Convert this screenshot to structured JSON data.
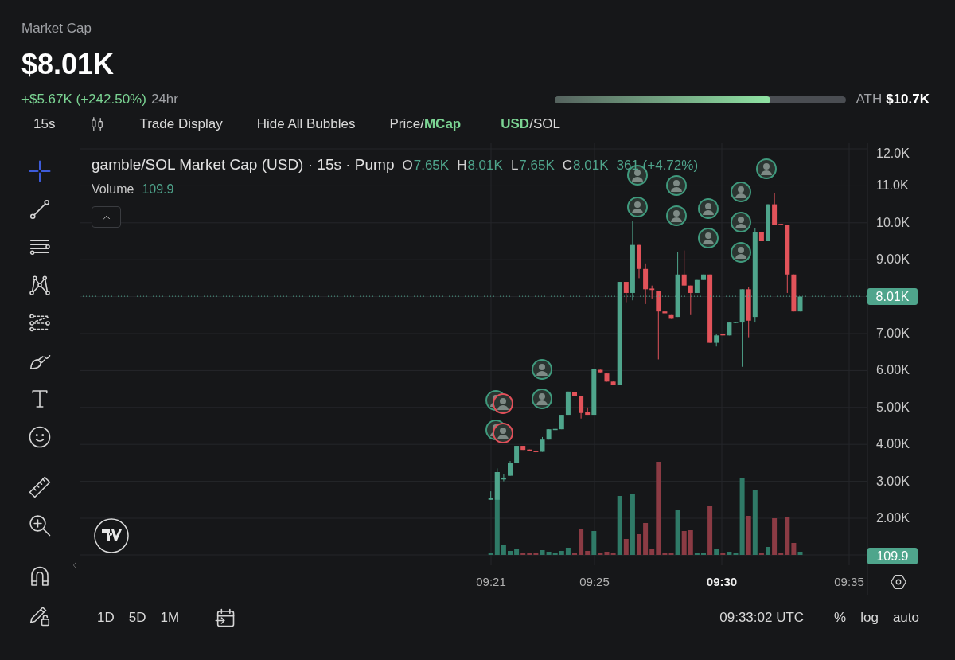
{
  "header": {
    "label": "Market Cap",
    "value": "$8.01K",
    "change": "+$5.67K (+242.50%)",
    "period": "24hr"
  },
  "ath": {
    "label": "ATH",
    "value": "$10.7K",
    "level": 0.74
  },
  "toolbar": {
    "interval": "15s",
    "buttons": [
      "Trade Display",
      "Hide All Bubbles"
    ],
    "toggles": [
      {
        "separator": "/",
        "options": [
          {
            "label": "Price",
            "selected": false
          },
          {
            "label": "MCap",
            "selected": true
          }
        ]
      },
      {
        "separator": "/",
        "options": [
          {
            "label": "USD",
            "selected": true
          },
          {
            "label": "SOL",
            "selected": false
          }
        ]
      }
    ]
  },
  "drawing_tools": [
    {
      "kind": "crosshair",
      "selected": true
    },
    {
      "kind": "trend",
      "selected": false
    },
    {
      "kind": "lines",
      "selected": false
    },
    {
      "kind": "pattern",
      "selected": false
    },
    {
      "kind": "fib",
      "selected": false
    },
    {
      "kind": "brush",
      "selected": false
    },
    {
      "kind": "text",
      "selected": false
    },
    {
      "kind": "emoji",
      "selected": false
    },
    {
      "kind": "ruler",
      "selected": false
    },
    {
      "kind": "zoom",
      "selected": false
    },
    {
      "kind": "magnet",
      "selected": false
    },
    {
      "kind": "lock",
      "selected": false
    }
  ],
  "chart": {
    "title": "gamble/SOL Market Cap (USD) · 15s · Pump",
    "ohlc": [
      {
        "key": "O",
        "value": "7.65K"
      },
      {
        "key": "H",
        "value": "8.01K"
      },
      {
        "key": "L",
        "value": "7.65K"
      },
      {
        "key": "C",
        "value": "8.01K"
      }
    ],
    "change": "361 (+4.72%)",
    "volume_label": "Volume",
    "volume_value": "109.9",
    "y_ticks": [
      "12.0K",
      "11.0K",
      "10.0K",
      "9.00K",
      "7.00K",
      "6.00K",
      "5.00K",
      "4.00K",
      "3.00K",
      "2.00K"
    ],
    "x_ticks": [
      {
        "label": "09:21",
        "bold": false
      },
      {
        "label": "09:25",
        "bold": false
      },
      {
        "label": "09:30",
        "bold": true
      },
      {
        "label": "09:35",
        "bold": false
      }
    ],
    "price_tag": "8.01K",
    "volume_tag": "109.9",
    "bubbles": [
      {
        "kind": "buy"
      },
      {
        "kind": "sell"
      },
      {
        "kind": "buy"
      },
      {
        "kind": "sell"
      },
      {
        "kind": "buy"
      },
      {
        "kind": "buy"
      },
      {
        "kind": "buy"
      },
      {
        "kind": "buy"
      },
      {
        "kind": "buy"
      },
      {
        "kind": "buy"
      },
      {
        "kind": "buy"
      },
      {
        "kind": "buy"
      },
      {
        "kind": "buy"
      },
      {
        "kind": "buy"
      },
      {
        "kind": "buy"
      },
      {
        "kind": "buy"
      }
    ]
  },
  "bottom_bar": {
    "ranges": [
      "1D",
      "5D",
      "1M"
    ],
    "time": "09:33:02 UTC",
    "scale_options": [
      "%",
      "log",
      "auto"
    ]
  }
}
